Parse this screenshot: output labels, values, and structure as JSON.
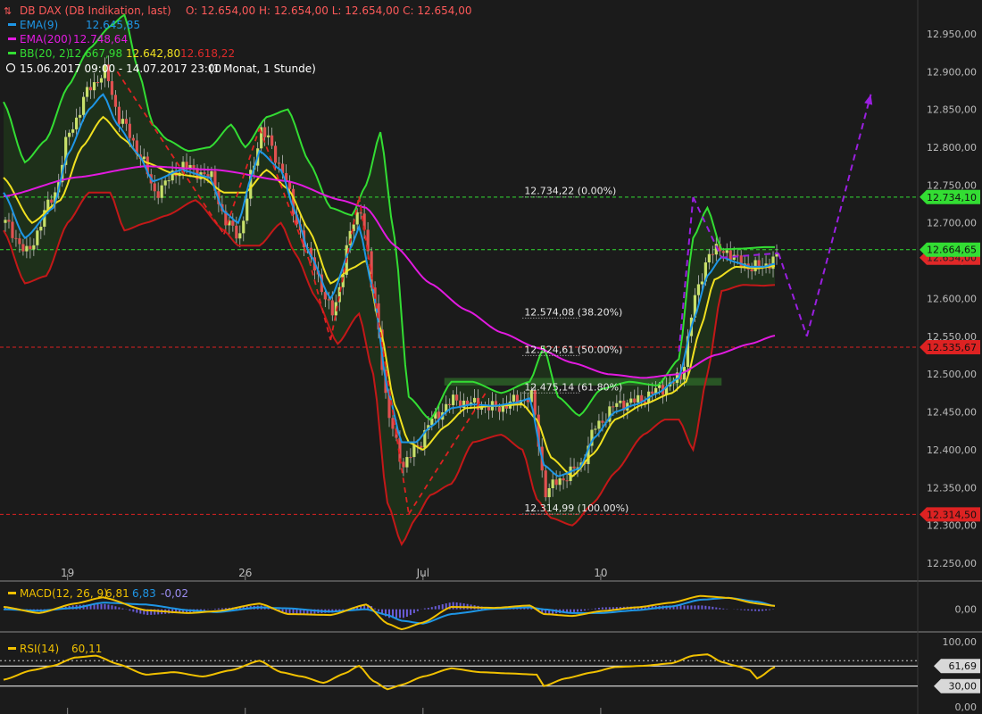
{
  "header": {
    "instrument": "DB DAX (DB Indikation, last)",
    "ohlc": "O: 12.654,00  H: 12.654,00  L: 12.654,00  C: 12.654,00",
    "ema9": "EMA(9)",
    "ema9_val": "12.645,85",
    "ema200": "EMA(200)",
    "ema200_val": "12.748,64",
    "bb": "BB(20, 2)",
    "bb_upper": "12.667,98",
    "bb_mid": "12.642,80",
    "bb_lower": "12.618,22",
    "period": "15.06.2017 09:00 - 14.07.2017 23:00",
    "period_note": "(1 Monat, 1 Stunde)"
  },
  "colors": {
    "background": "#1b1b1b",
    "candle_up": "#c8e06a",
    "candle_down": "#e05050",
    "ema9": "#1e96e6",
    "ema200": "#e21ae0",
    "bb_upper": "#33dd33",
    "bb_mid": "#f0e020",
    "bb_lower": "#c31818",
    "bb_fill": "#1f331b",
    "fib_line": "#cccccc",
    "green_level": "#33dd33",
    "red_level": "#dd2222",
    "projection": "#9a1fe0",
    "dashed_red": "#dd2222",
    "macd": "#f0c000",
    "signal": "#1e96e6",
    "histogram": "#6a5cd8",
    "rsi": "#f0c000"
  },
  "chart_data": {
    "type": "candlestick",
    "y_range": [
      12230,
      12990
    ],
    "y_ticks": [
      {
        "v": 12950,
        "label": "12.950,00"
      },
      {
        "v": 12900,
        "label": "12.900,00"
      },
      {
        "v": 12850,
        "label": "12.850,00"
      },
      {
        "v": 12800,
        "label": "12.800,00"
      },
      {
        "v": 12750,
        "label": "12.750,00"
      },
      {
        "v": 12700,
        "label": "12.700,00"
      },
      {
        "v": 12650,
        "label": "12.650,00"
      },
      {
        "v": 12600,
        "label": "12.600,00"
      },
      {
        "v": 12550,
        "label": "12.550,00"
      },
      {
        "v": 12500,
        "label": "12.500,00"
      },
      {
        "v": 12450,
        "label": "12.450,00"
      },
      {
        "v": 12400,
        "label": "12.400,00"
      },
      {
        "v": 12350,
        "label": "12.350,00"
      },
      {
        "v": 12300,
        "label": "12.300,00"
      },
      {
        "v": 12250,
        "label": "12.250,00"
      }
    ],
    "x_ticks": [
      {
        "bar": 18,
        "label": "19"
      },
      {
        "bar": 68,
        "label": "26"
      },
      {
        "bar": 118,
        "label": "Jul"
      },
      {
        "bar": 168,
        "label": "10"
      }
    ],
    "bar_count": 218,
    "price_path": [
      [
        0,
        12700
      ],
      [
        6,
        12660
      ],
      [
        14,
        12740
      ],
      [
        18,
        12820
      ],
      [
        24,
        12880
      ],
      [
        28,
        12900
      ],
      [
        32,
        12840
      ],
      [
        38,
        12790
      ],
      [
        42,
        12740
      ],
      [
        50,
        12775
      ],
      [
        58,
        12760
      ],
      [
        62,
        12700
      ],
      [
        66,
        12685
      ],
      [
        70,
        12780
      ],
      [
        72,
        12825
      ],
      [
        78,
        12770
      ],
      [
        82,
        12700
      ],
      [
        86,
        12650
      ],
      [
        92,
        12580
      ],
      [
        98,
        12700
      ],
      [
        100,
        12720
      ],
      [
        104,
        12590
      ],
      [
        108,
        12440
      ],
      [
        112,
        12380
      ],
      [
        116,
        12405
      ],
      [
        120,
        12440
      ],
      [
        126,
        12465
      ],
      [
        132,
        12460
      ],
      [
        138,
        12455
      ],
      [
        144,
        12465
      ],
      [
        148,
        12470
      ],
      [
        152,
        12345
      ],
      [
        156,
        12360
      ],
      [
        162,
        12380
      ],
      [
        166,
        12430
      ],
      [
        172,
        12460
      ],
      [
        178,
        12465
      ],
      [
        184,
        12480
      ],
      [
        190,
        12495
      ],
      [
        194,
        12600
      ],
      [
        198,
        12660
      ],
      [
        202,
        12665
      ],
      [
        206,
        12650
      ],
      [
        210,
        12640
      ],
      [
        214,
        12645
      ],
      [
        217,
        12654
      ]
    ],
    "ema9_path": [
      [
        0,
        12740
      ],
      [
        6,
        12680
      ],
      [
        14,
        12720
      ],
      [
        18,
        12790
      ],
      [
        24,
        12850
      ],
      [
        28,
        12870
      ],
      [
        32,
        12830
      ],
      [
        38,
        12790
      ],
      [
        42,
        12755
      ],
      [
        50,
        12770
      ],
      [
        58,
        12760
      ],
      [
        62,
        12715
      ],
      [
        66,
        12700
      ],
      [
        70,
        12765
      ],
      [
        72,
        12795
      ],
      [
        78,
        12770
      ],
      [
        82,
        12715
      ],
      [
        86,
        12660
      ],
      [
        92,
        12600
      ],
      [
        98,
        12670
      ],
      [
        100,
        12695
      ],
      [
        104,
        12610
      ],
      [
        108,
        12480
      ],
      [
        112,
        12410
      ],
      [
        116,
        12410
      ],
      [
        120,
        12430
      ],
      [
        126,
        12455
      ],
      [
        132,
        12460
      ],
      [
        138,
        12458
      ],
      [
        144,
        12462
      ],
      [
        148,
        12468
      ],
      [
        152,
        12380
      ],
      [
        156,
        12365
      ],
      [
        162,
        12375
      ],
      [
        166,
        12415
      ],
      [
        172,
        12450
      ],
      [
        178,
        12460
      ],
      [
        184,
        12475
      ],
      [
        190,
        12495
      ],
      [
        194,
        12570
      ],
      [
        198,
        12630
      ],
      [
        202,
        12655
      ],
      [
        206,
        12648
      ],
      [
        210,
        12642
      ],
      [
        214,
        12642
      ],
      [
        217,
        12646
      ]
    ],
    "bb_mid_path": [
      [
        0,
        12760
      ],
      [
        8,
        12700
      ],
      [
        16,
        12730
      ],
      [
        22,
        12800
      ],
      [
        28,
        12840
      ],
      [
        34,
        12810
      ],
      [
        40,
        12780
      ],
      [
        48,
        12765
      ],
      [
        56,
        12760
      ],
      [
        62,
        12740
      ],
      [
        68,
        12740
      ],
      [
        74,
        12770
      ],
      [
        80,
        12745
      ],
      [
        86,
        12690
      ],
      [
        92,
        12620
      ],
      [
        98,
        12640
      ],
      [
        102,
        12650
      ],
      [
        106,
        12560
      ],
      [
        110,
        12460
      ],
      [
        114,
        12410
      ],
      [
        118,
        12400
      ],
      [
        124,
        12430
      ],
      [
        130,
        12455
      ],
      [
        138,
        12458
      ],
      [
        146,
        12460
      ],
      [
        150,
        12440
      ],
      [
        154,
        12390
      ],
      [
        160,
        12365
      ],
      [
        166,
        12395
      ],
      [
        172,
        12440
      ],
      [
        180,
        12460
      ],
      [
        188,
        12475
      ],
      [
        192,
        12490
      ],
      [
        196,
        12560
      ],
      [
        200,
        12625
      ],
      [
        206,
        12642
      ],
      [
        212,
        12640
      ],
      [
        217,
        12643
      ]
    ],
    "bb_upper_path": [
      [
        0,
        12860
      ],
      [
        6,
        12780
      ],
      [
        12,
        12810
      ],
      [
        18,
        12880
      ],
      [
        24,
        12930
      ],
      [
        30,
        12960
      ],
      [
        34,
        12975
      ],
      [
        38,
        12900
      ],
      [
        42,
        12830
      ],
      [
        46,
        12810
      ],
      [
        52,
        12795
      ],
      [
        58,
        12800
      ],
      [
        64,
        12830
      ],
      [
        68,
        12800
      ],
      [
        74,
        12840
      ],
      [
        80,
        12850
      ],
      [
        86,
        12780
      ],
      [
        92,
        12720
      ],
      [
        98,
        12710
      ],
      [
        102,
        12750
      ],
      [
        106,
        12820
      ],
      [
        110,
        12680
      ],
      [
        114,
        12470
      ],
      [
        120,
        12440
      ],
      [
        126,
        12490
      ],
      [
        132,
        12490
      ],
      [
        140,
        12475
      ],
      [
        148,
        12490
      ],
      [
        152,
        12535
      ],
      [
        156,
        12470
      ],
      [
        162,
        12445
      ],
      [
        168,
        12480
      ],
      [
        176,
        12490
      ],
      [
        184,
        12485
      ],
      [
        190,
        12520
      ],
      [
        194,
        12680
      ],
      [
        198,
        12720
      ],
      [
        202,
        12665
      ],
      [
        208,
        12666
      ],
      [
        214,
        12668
      ],
      [
        217,
        12668
      ]
    ],
    "bb_lower_path": [
      [
        0,
        12690
      ],
      [
        6,
        12620
      ],
      [
        12,
        12630
      ],
      [
        18,
        12700
      ],
      [
        24,
        12740
      ],
      [
        30,
        12740
      ],
      [
        34,
        12690
      ],
      [
        40,
        12700
      ],
      [
        46,
        12710
      ],
      [
        54,
        12730
      ],
      [
        62,
        12690
      ],
      [
        66,
        12670
      ],
      [
        72,
        12670
      ],
      [
        78,
        12700
      ],
      [
        82,
        12660
      ],
      [
        88,
        12600
      ],
      [
        94,
        12540
      ],
      [
        100,
        12580
      ],
      [
        104,
        12500
      ],
      [
        108,
        12330
      ],
      [
        112,
        12275
      ],
      [
        116,
        12310
      ],
      [
        120,
        12340
      ],
      [
        126,
        12355
      ],
      [
        132,
        12410
      ],
      [
        140,
        12420
      ],
      [
        146,
        12400
      ],
      [
        150,
        12335
      ],
      [
        154,
        12310
      ],
      [
        160,
        12300
      ],
      [
        166,
        12330
      ],
      [
        172,
        12370
      ],
      [
        180,
        12420
      ],
      [
        186,
        12440
      ],
      [
        190,
        12440
      ],
      [
        194,
        12400
      ],
      [
        198,
        12500
      ],
      [
        202,
        12610
      ],
      [
        208,
        12618
      ],
      [
        214,
        12617
      ],
      [
        217,
        12618
      ]
    ],
    "ema200_path": [
      [
        0,
        12735
      ],
      [
        20,
        12760
      ],
      [
        40,
        12775
      ],
      [
        60,
        12770
      ],
      [
        80,
        12755
      ],
      [
        95,
        12730
      ],
      [
        102,
        12720
      ],
      [
        110,
        12670
      ],
      [
        120,
        12620
      ],
      [
        130,
        12585
      ],
      [
        140,
        12555
      ],
      [
        150,
        12535
      ],
      [
        160,
        12515
      ],
      [
        170,
        12500
      ],
      [
        180,
        12495
      ],
      [
        190,
        12500
      ],
      [
        200,
        12525
      ],
      [
        210,
        12540
      ],
      [
        217,
        12551
      ]
    ],
    "horizontal_levels": [
      {
        "kind": "green",
        "value": 12734.1,
        "label": "12.734,10"
      },
      {
        "kind": "green",
        "value": 12664.65,
        "label": "12.664,65"
      },
      {
        "kind": "red",
        "value": 12535.67,
        "label": "12.535,67"
      },
      {
        "kind": "red",
        "value": 12314.5,
        "label": "12.314,50"
      }
    ],
    "fib_levels": [
      {
        "value": 12734.22,
        "label": "12.734,22 (0.00%)"
      },
      {
        "value": 12574.08,
        "label": "12.574,08 (38.20%)"
      },
      {
        "value": 12524.61,
        "label": "12.524,61 (50.00%)"
      },
      {
        "value": 12475.14,
        "label": "12.475,14 (61.80%)"
      },
      {
        "value": 12314.99,
        "label": "12.314,99 (100.00%)"
      }
    ],
    "fib_bar_range": [
      146,
      162
    ],
    "current_price_label": "12.654,00",
    "red_dashed_path": [
      [
        32,
        12900
      ],
      [
        62,
        12685
      ],
      [
        72,
        12825
      ],
      [
        86,
        12650
      ],
      [
        92,
        12545
      ],
      [
        100,
        12735
      ],
      [
        114,
        12315
      ],
      [
        136,
        12478
      ]
    ],
    "projection_path": [
      [
        190,
        12530
      ],
      [
        194,
        12734
      ],
      [
        202,
        12654
      ],
      [
        218,
        12660
      ],
      [
        226,
        12550
      ],
      [
        244,
        12870
      ]
    ],
    "zone": {
      "bar_from": 124,
      "bar_to": 202,
      "low": 12485,
      "high": 12495
    },
    "macd": {
      "label": "MACD(12, 26, 9)",
      "macd_val": "6,81",
      "signal_val": "6,83",
      "hist_val": "-0,02",
      "range": [
        -40,
        50
      ],
      "tick_label": "0,00",
      "macd_path": [
        [
          0,
          5
        ],
        [
          10,
          -8
        ],
        [
          20,
          12
        ],
        [
          28,
          25
        ],
        [
          40,
          -2
        ],
        [
          52,
          -8
        ],
        [
          60,
          -4
        ],
        [
          72,
          12
        ],
        [
          80,
          -10
        ],
        [
          92,
          -12
        ],
        [
          102,
          10
        ],
        [
          108,
          -30
        ],
        [
          112,
          -42
        ],
        [
          118,
          -28
        ],
        [
          126,
          5
        ],
        [
          138,
          3
        ],
        [
          148,
          8
        ],
        [
          152,
          -10
        ],
        [
          160,
          -14
        ],
        [
          168,
          -4
        ],
        [
          178,
          4
        ],
        [
          188,
          14
        ],
        [
          196,
          28
        ],
        [
          204,
          24
        ],
        [
          212,
          12
        ],
        [
          217,
          7
        ]
      ],
      "signal_path": [
        [
          0,
          0
        ],
        [
          10,
          -3
        ],
        [
          20,
          3
        ],
        [
          28,
          14
        ],
        [
          40,
          10
        ],
        [
          52,
          -2
        ],
        [
          60,
          -6
        ],
        [
          72,
          4
        ],
        [
          80,
          2
        ],
        [
          92,
          -5
        ],
        [
          102,
          0
        ],
        [
          108,
          -12
        ],
        [
          112,
          -24
        ],
        [
          118,
          -30
        ],
        [
          126,
          -10
        ],
        [
          138,
          1
        ],
        [
          148,
          4
        ],
        [
          152,
          0
        ],
        [
          160,
          -8
        ],
        [
          168,
          -8
        ],
        [
          178,
          -2
        ],
        [
          188,
          6
        ],
        [
          196,
          20
        ],
        [
          204,
          24
        ],
        [
          212,
          16
        ],
        [
          217,
          7
        ]
      ]
    },
    "rsi": {
      "label": "RSI(14)",
      "value": "60,11",
      "range": [
        0,
        100
      ],
      "levels": [
        {
          "v": 100,
          "label": "100,00"
        },
        {
          "v": 61.69,
          "label": "61,69"
        },
        {
          "v": 30,
          "label": "30,00"
        },
        {
          "v": 0,
          "label": "0,00"
        }
      ],
      "path": [
        [
          0,
          40
        ],
        [
          8,
          55
        ],
        [
          14,
          62
        ],
        [
          20,
          75
        ],
        [
          26,
          78
        ],
        [
          32,
          65
        ],
        [
          40,
          48
        ],
        [
          48,
          52
        ],
        [
          56,
          45
        ],
        [
          64,
          55
        ],
        [
          72,
          70
        ],
        [
          78,
          52
        ],
        [
          84,
          45
        ],
        [
          90,
          35
        ],
        [
          96,
          50
        ],
        [
          100,
          62
        ],
        [
          104,
          38
        ],
        [
          108,
          25
        ],
        [
          112,
          32
        ],
        [
          118,
          45
        ],
        [
          126,
          58
        ],
        [
          134,
          52
        ],
        [
          142,
          50
        ],
        [
          150,
          48
        ],
        [
          152,
          30
        ],
        [
          158,
          42
        ],
        [
          166,
          52
        ],
        [
          172,
          60
        ],
        [
          180,
          62
        ],
        [
          188,
          66
        ],
        [
          194,
          78
        ],
        [
          198,
          80
        ],
        [
          202,
          68
        ],
        [
          206,
          62
        ],
        [
          210,
          55
        ],
        [
          212,
          42
        ],
        [
          217,
          60
        ]
      ]
    }
  }
}
